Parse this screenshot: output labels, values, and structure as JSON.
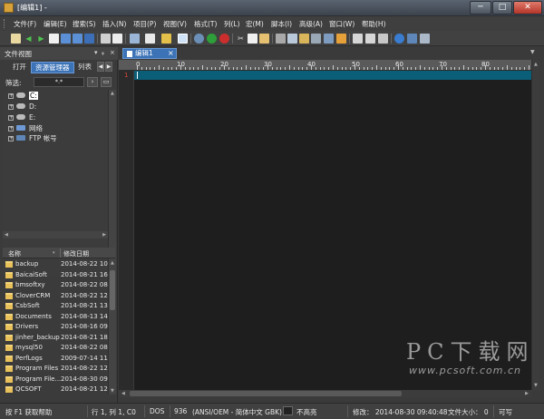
{
  "window": {
    "title": "[编辑1] -",
    "controls": {
      "minimize": "─",
      "maximize": "□",
      "close": "✕"
    }
  },
  "menu": [
    "文件(F)",
    "编辑(E)",
    "搜索(S)",
    "插入(N)",
    "项目(P)",
    "视图(V)",
    "格式(T)",
    "列(L)",
    "宏(M)",
    "脚本(I)",
    "高级(A)",
    "窗口(W)",
    "帮助(H)"
  ],
  "toolbar_icons": [
    "new-file-icon",
    "back-icon",
    "forward-icon",
    "open-icon",
    "save-icon",
    "save-all-icon",
    "close-file-icon",
    "print-icon",
    "print-preview-icon",
    "properties-icon",
    "word-wrap-icon",
    "column-mode-icon",
    "hex-icon",
    "browser-icon",
    "green-run-icon",
    "red-stop-icon",
    "cut-icon",
    "copy-icon",
    "paste-icon",
    "find-icon",
    "replace-icon",
    "find-in-files-icon",
    "goto-icon",
    "compare-icon",
    "window-icon",
    "layout-icon",
    "split-icon",
    "globe-icon",
    "ftp-icon",
    "help-icon"
  ],
  "file_view": {
    "title": "文件视图",
    "pin": "ᵩ",
    "close": "×",
    "tabs": [
      "打开",
      "资源管理器",
      "列表"
    ],
    "active_tab": "资源管理器",
    "filter_label": "筛选:",
    "filter_value": "*.*",
    "tree": [
      {
        "label": "C:",
        "selected": true
      },
      {
        "label": "D:",
        "selected": false
      },
      {
        "label": "E:",
        "selected": false
      },
      {
        "label": "网络",
        "selected": false
      },
      {
        "label": "FTP 帐号",
        "selected": false
      }
    ],
    "columns": {
      "name": "名称",
      "date": "修改日期"
    },
    "files": [
      {
        "name": "backup",
        "date": "2014-08-22 10"
      },
      {
        "name": "BaicaiSoft",
        "date": "2014-08-21 16"
      },
      {
        "name": "bmsoftxy",
        "date": "2014-08-22 08"
      },
      {
        "name": "CloverCRM",
        "date": "2014-08-22 12"
      },
      {
        "name": "CsbSoft",
        "date": "2014-08-21 13"
      },
      {
        "name": "Documents",
        "date": "2014-08-13 14"
      },
      {
        "name": "Drivers",
        "date": "2014-08-16 09"
      },
      {
        "name": "jinher_backup",
        "date": "2014-08-21 18"
      },
      {
        "name": "mysql50",
        "date": "2014-08-22 08"
      },
      {
        "name": "PerfLogs",
        "date": "2009-07-14 11"
      },
      {
        "name": "Program Files",
        "date": "2014-08-22 12"
      },
      {
        "name": "Program File...",
        "date": "2014-08-30 09"
      },
      {
        "name": "QCSOFT",
        "date": "2014-08-21 12"
      }
    ]
  },
  "editor": {
    "tab_label": "编辑1",
    "tab_close": "×",
    "line_number": "1",
    "ruler_labels": [
      "0",
      "10",
      "20",
      "30",
      "40",
      "50",
      "60",
      "70",
      "80"
    ]
  },
  "status": {
    "help": "按 F1 获取帮助",
    "position": "行 1, 列 1, C0",
    "line_ending": "DOS",
    "codepage": "936",
    "encoding": "(ANSI/OEM - 简体中文 GBK)",
    "highlight": "不高亮",
    "modified": "修改： 2014-08-30 09:40:48",
    "filesize": "文件大小： 0",
    "mode": "可写"
  },
  "watermark": {
    "line1": "PC下载网",
    "line2": "www.pcsoft.com.cn"
  },
  "colors": {
    "accent": "#3c73b7",
    "current_line": "#0b5e78",
    "editor_bg": "#1e1e1e"
  }
}
